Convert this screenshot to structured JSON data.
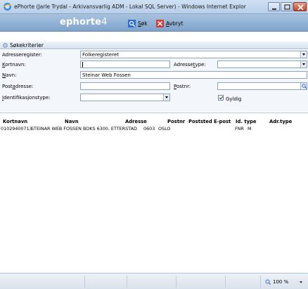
{
  "window": {
    "title": "ePhorte (Jarle Trydal - Arkivansvarlig ADM - Lokal SQL Server) - Windows Internet Explor..."
  },
  "toolbar": {
    "logo_main": "ephorte",
    "logo_version": "4",
    "sok_label": "Søk",
    "sok_underline": "S",
    "sok_rest": "øk",
    "avbryt_underline": "A",
    "avbryt_rest": "vbryt"
  },
  "criteria": {
    "title": "Søkekriterier",
    "adresseregister_label": "Adresseregister:",
    "adresseregister_value": "Folkeregisteret",
    "kortnavn_label_u": "K",
    "kortnavn_label_rest": "ortnavn:",
    "kortnavn_value": "",
    "adressetype_label_pre": "Adresse",
    "adressetype_label_u": "t",
    "adressetype_label_rest": "ype:",
    "adressetype_value": "",
    "navn_label_u": "N",
    "navn_label_rest": "avn:",
    "navn_value": "Steinar Web Fossen",
    "postadresse_label_pre": "Post",
    "postadresse_label_u": "a",
    "postadresse_label_rest": "dresse:",
    "postadresse_value": "",
    "postnr_label_u": "P",
    "postnr_label_rest": "ostnr:",
    "postnr_value": "",
    "idtype_label_u": "I",
    "idtype_label_rest": "dentifikasjonstype:",
    "idtype_value": "",
    "gyldig_label": "Gyldig",
    "gyldig_checked": true
  },
  "results": {
    "columns": [
      "Kortnavn",
      "Navn",
      "Adresse",
      "Postnr",
      "Poststed",
      "E-post",
      "Id. type",
      "Adr.type"
    ],
    "rows": [
      {
        "kortnavn": "01029400713",
        "navn": "STEINAR WEB FOSSEN",
        "adresse": "BOKS 6300, ETTERSTAD",
        "postnr": "0603",
        "poststed": "OSLO",
        "epost": "",
        "idtype": "FNR",
        "adrtype": "M"
      }
    ]
  },
  "status": {
    "zoom": "100 %"
  },
  "colors": {
    "banner": "#7fa3cb",
    "accent": "#1e62c0"
  }
}
